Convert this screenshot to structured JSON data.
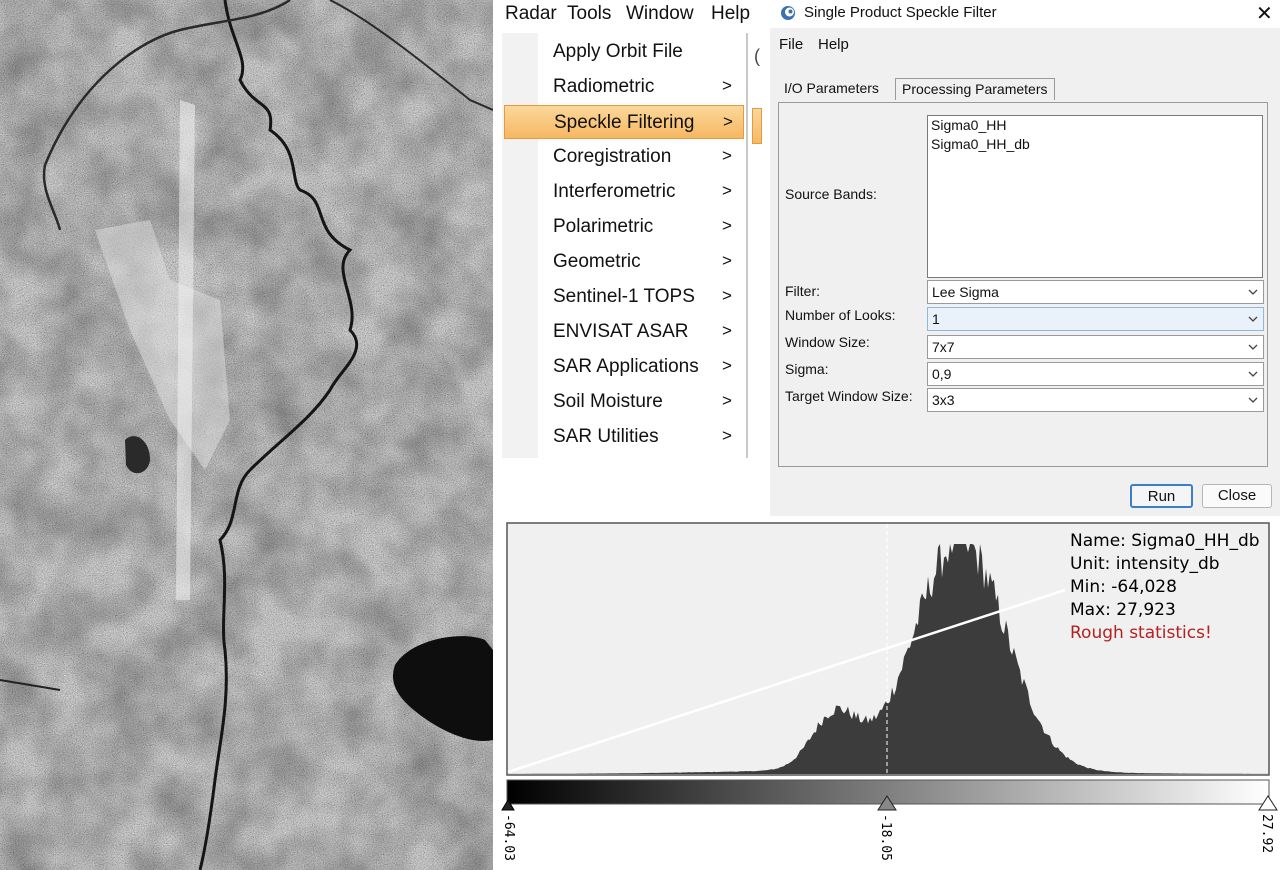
{
  "sar_image": {
    "description_icon": "sar-image"
  },
  "radar_menu": {
    "menubar": [
      "Radar",
      "Tools",
      "Window",
      "Help"
    ],
    "items": [
      {
        "label": "Apply Orbit File",
        "arrow": ""
      },
      {
        "label": "Radiometric",
        "arrow": ">"
      },
      {
        "label": "Speckle Filtering",
        "arrow": ">",
        "highlighted": true
      },
      {
        "label": "Coregistration",
        "arrow": ">"
      },
      {
        "label": "Interferometric",
        "arrow": ">"
      },
      {
        "label": "Polarimetric",
        "arrow": ">"
      },
      {
        "label": "Geometric",
        "arrow": ">"
      },
      {
        "label": "Sentinel-1 TOPS",
        "arrow": ">"
      },
      {
        "label": "ENVISAT ASAR",
        "arrow": ">"
      },
      {
        "label": "SAR Applications",
        "arrow": ">"
      },
      {
        "label": "Soil Moisture",
        "arrow": ">"
      },
      {
        "label": "SAR Utilities",
        "arrow": ">"
      }
    ],
    "highlight_color": "#f8c57a"
  },
  "dialog": {
    "title": "Single Product Speckle Filter",
    "close_glyph": "✕",
    "menu": [
      "File",
      "Help"
    ],
    "tabs": [
      {
        "label": "I/O Parameters",
        "active": false
      },
      {
        "label": "Processing Parameters",
        "active": true
      }
    ],
    "source_bands_label": "Source Bands:",
    "source_bands": [
      "Sigma0_HH",
      "Sigma0_HH_db"
    ],
    "params": [
      {
        "label": "Filter:",
        "value": "Lee Sigma",
        "focused": false
      },
      {
        "label": "Number of Looks:",
        "value": "1",
        "focused": true
      },
      {
        "label": "Window Size:",
        "value": "7x7",
        "focused": false
      },
      {
        "label": "Sigma:",
        "value": "0,9",
        "focused": false
      },
      {
        "label": "Target Window Size:",
        "value": "3x3",
        "focused": false
      }
    ],
    "buttons": {
      "run": "Run",
      "close": "Close"
    },
    "accent_color": "#3c7fc4"
  },
  "histogram": {
    "info": {
      "name": "Name: Sigma0_HH_db",
      "unit": "Unit: intensity_db",
      "min": "Min: -64,028",
      "max": "Max: 27,923",
      "warning": "Rough statistics!"
    },
    "warning_color": "#b22222",
    "slider_labels": [
      "-64.03",
      "-18.05",
      "27.92"
    ]
  }
}
